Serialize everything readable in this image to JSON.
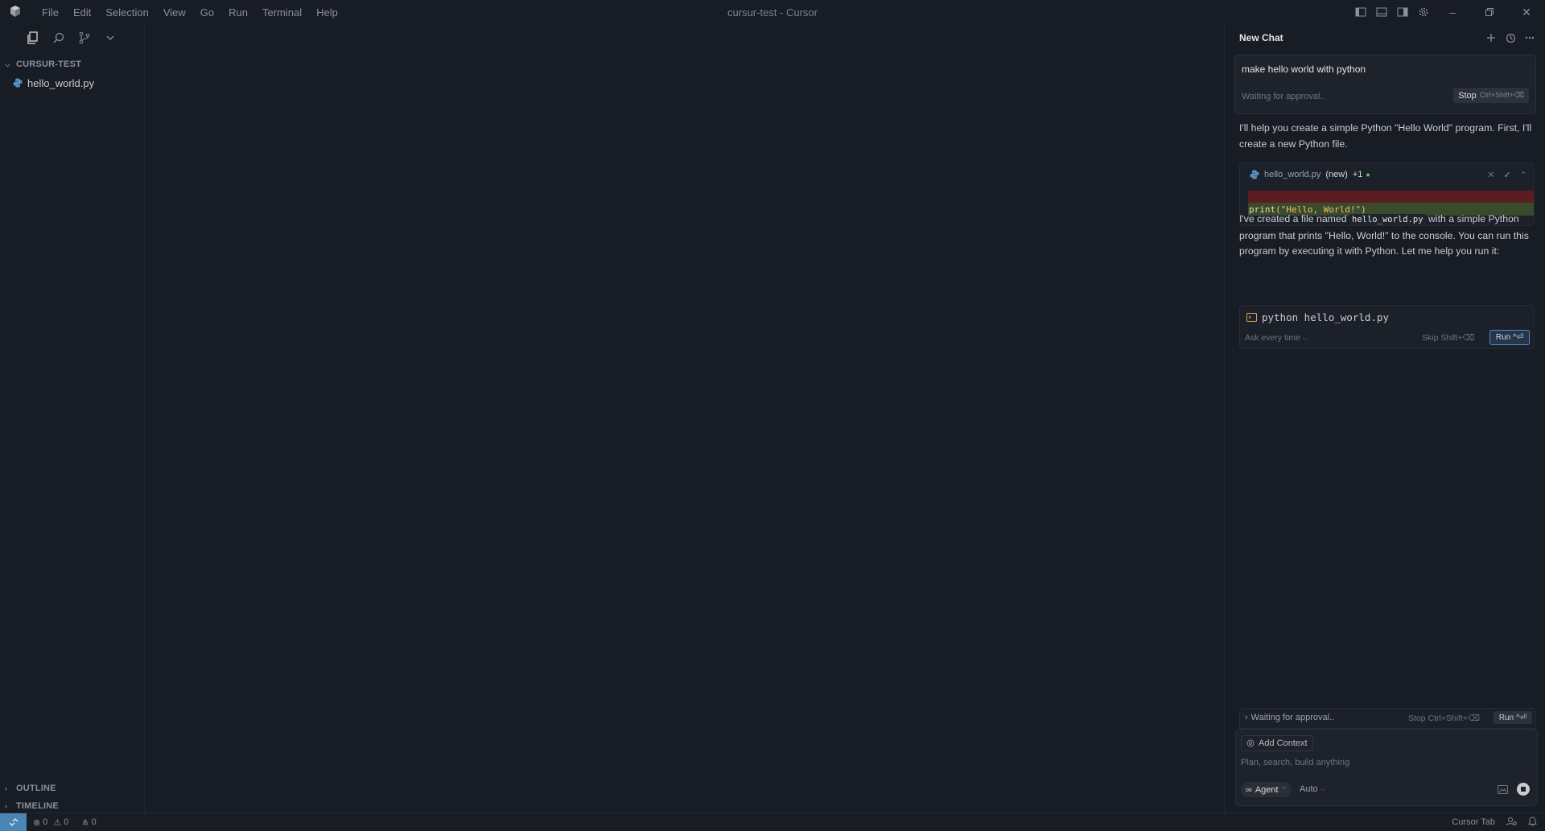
{
  "window": {
    "title": "cursur-test - Cursor"
  },
  "menu": [
    "File",
    "Edit",
    "Selection",
    "View",
    "Go",
    "Run",
    "Terminal",
    "Help"
  ],
  "explorer": {
    "section_title": "CURSUR-TEST",
    "files": [
      "hello_world.py"
    ],
    "outline_label": "OUTLINE",
    "timeline_label": "TIMELINE"
  },
  "chat": {
    "title": "New Chat",
    "user_message": "make hello world with python",
    "waiting": "Waiting for approval..",
    "stop_label": "Stop",
    "stop_shortcut": "Ctrl+Shift+⌫",
    "para1": "I'll help you create a simple Python \"Hello World\" program. First, I'll create a new Python file.",
    "diff": {
      "filename": "hello_world.py",
      "tag": "(new)",
      "changes": "+1",
      "code_func": "print",
      "code_str": "(\"Hello, World!\")"
    },
    "para2_prefix": "I've created a file named",
    "para2_code": "hello_world.py",
    "para2_suffix": "with a simple Python program that prints \"Hello, World!\" to the console. You can run this program by executing it with Python. Let me help you run it:",
    "terminal": {
      "command": "python hello_world.py",
      "ask_label": "Ask every time",
      "skip_label": "Skip Shift+⌫",
      "run_label": "Run ^⏎"
    },
    "bottom_wait": "Waiting for approval..",
    "bottom_stop": "Stop Ctrl+Shift+⌫",
    "bottom_run": "Run ^⏎",
    "add_context": "Add Context",
    "placeholder": "Plan, search, build anything",
    "agent_label": "Agent",
    "model_label": "Auto"
  },
  "status": {
    "errors": "0",
    "warnings": "0",
    "ports": "0",
    "cursor_tab": "Cursor Tab"
  },
  "colors": {
    "background": "#181c24",
    "accent": "#4a86b5",
    "diff_removed": "#5b1c22",
    "diff_added": "#3a4a2c"
  }
}
